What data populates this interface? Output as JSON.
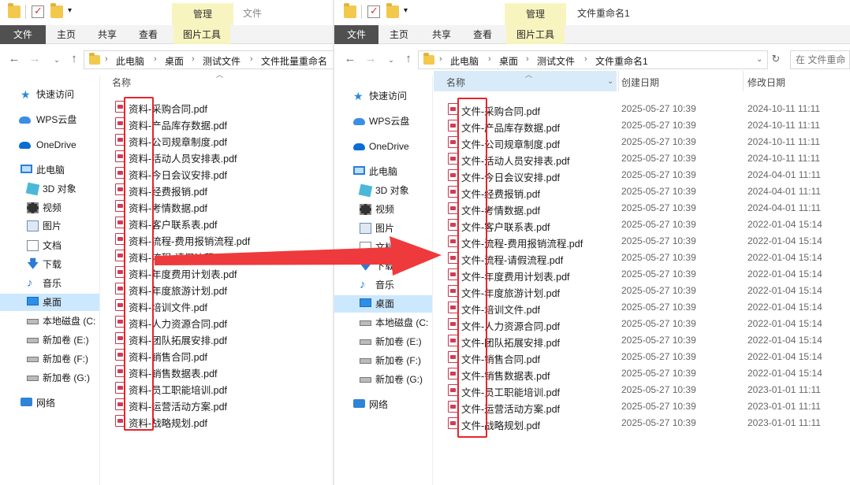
{
  "left_window": {
    "ribbon_context_tab": "管理",
    "title": "文件",
    "ribbon_tabs": [
      "文件",
      "主页",
      "共享",
      "查看",
      "图片工具"
    ],
    "breadcrumb": [
      "此电脑",
      "桌面",
      "测试文件",
      "文件批量重命名"
    ],
    "nav_items": [
      "快速访问",
      "WPS云盘",
      "OneDrive",
      "此电脑",
      "3D 对象",
      "视频",
      "图片",
      "文档",
      "下载",
      "音乐",
      "桌面",
      "本地磁盘 (C:",
      "新加卷 (E:)",
      "新加卷 (F:)",
      "新加卷 (G:)",
      "网络"
    ],
    "column_name": "名称",
    "files": [
      "资料-采购合同.pdf",
      "资料-产品库存数据.pdf",
      "资料-公司规章制度.pdf",
      "资料-活动人员安排表.pdf",
      "资料-今日会议安排.pdf",
      "资料-经费报销.pdf",
      "资料-考情数据.pdf",
      "资料-客户联系表.pdf",
      "资料-流程-费用报销流程.pdf",
      "资料-流程-请假流程.pdf",
      "资料-年度费用计划表.pdf",
      "资料-年度旅游计划.pdf",
      "资料-培训文件.pdf",
      "资料-人力资源合同.pdf",
      "资料-团队拓展安排.pdf",
      "资料-销售合同.pdf",
      "资料-销售数据表.pdf",
      "资料-员工职能培训.pdf",
      "资料-运营活动方案.pdf",
      "资料-战略规划.pdf"
    ]
  },
  "right_window": {
    "ribbon_context_tab": "管理",
    "title": "文件重命名1",
    "ribbon_tabs": [
      "文件",
      "主页",
      "共享",
      "查看",
      "图片工具"
    ],
    "breadcrumb": [
      "此电脑",
      "桌面",
      "测试文件",
      "文件重命名1"
    ],
    "search_placeholder": "在 文件重命",
    "nav_items": [
      "快速访问",
      "WPS云盘",
      "OneDrive",
      "此电脑",
      "3D 对象",
      "视频",
      "图片",
      "文档",
      "下载",
      "音乐",
      "桌面",
      "本地磁盘 (C:",
      "新加卷 (E:)",
      "新加卷 (F:)",
      "新加卷 (G:)",
      "网络"
    ],
    "columns": {
      "name": "名称",
      "created": "创建日期",
      "modified": "修改日期"
    },
    "files": [
      {
        "name": "文件-采购合同.pdf",
        "created": "2025-05-27 10:39",
        "modified": "2024-10-11 11:11"
      },
      {
        "name": "文件-产品库存数据.pdf",
        "created": "2025-05-27 10:39",
        "modified": "2024-10-11 11:11"
      },
      {
        "name": "文件-公司规章制度.pdf",
        "created": "2025-05-27 10:39",
        "modified": "2024-10-11 11:11"
      },
      {
        "name": "文件-活动人员安排表.pdf",
        "created": "2025-05-27 10:39",
        "modified": "2024-10-11 11:11"
      },
      {
        "name": "文件-今日会议安排.pdf",
        "created": "2025-05-27 10:39",
        "modified": "2024-04-01 11:11"
      },
      {
        "name": "文件-经费报销.pdf",
        "created": "2025-05-27 10:39",
        "modified": "2024-04-01 11:11"
      },
      {
        "name": "文件-考情数据.pdf",
        "created": "2025-05-27 10:39",
        "modified": "2024-04-01 11:11"
      },
      {
        "name": "文件-客户联系表.pdf",
        "created": "2025-05-27 10:39",
        "modified": "2022-01-04 15:14"
      },
      {
        "name": "文件-流程-费用报销流程.pdf",
        "created": "2025-05-27 10:39",
        "modified": "2022-01-04 15:14"
      },
      {
        "name": "文件-流程-请假流程.pdf",
        "created": "2025-05-27 10:39",
        "modified": "2022-01-04 15:14"
      },
      {
        "name": "文件-年度费用计划表.pdf",
        "created": "2025-05-27 10:39",
        "modified": "2022-01-04 15:14"
      },
      {
        "name": "文件-年度旅游计划.pdf",
        "created": "2025-05-27 10:39",
        "modified": "2022-01-04 15:14"
      },
      {
        "name": "文件-培训文件.pdf",
        "created": "2025-05-27 10:39",
        "modified": "2022-01-04 15:14"
      },
      {
        "name": "文件-人力资源合同.pdf",
        "created": "2025-05-27 10:39",
        "modified": "2022-01-04 15:14"
      },
      {
        "name": "文件-团队拓展安排.pdf",
        "created": "2025-05-27 10:39",
        "modified": "2022-01-04 15:14"
      },
      {
        "name": "文件-销售合同.pdf",
        "created": "2025-05-27 10:39",
        "modified": "2022-01-04 15:14"
      },
      {
        "name": "文件-销售数据表.pdf",
        "created": "2025-05-27 10:39",
        "modified": "2022-01-04 15:14"
      },
      {
        "name": "文件-员工职能培训.pdf",
        "created": "2025-05-27 10:39",
        "modified": "2023-01-01 11:11"
      },
      {
        "name": "文件-运营活动方案.pdf",
        "created": "2025-05-27 10:39",
        "modified": "2023-01-01 11:11"
      },
      {
        "name": "文件-战略规划.pdf",
        "created": "2025-05-27 10:39",
        "modified": "2023-01-01 11:11"
      }
    ]
  },
  "colors": {
    "highlight_red": "#e8242a",
    "selected_nav": "#cce8ff",
    "context_tab": "#f8f4bf"
  }
}
